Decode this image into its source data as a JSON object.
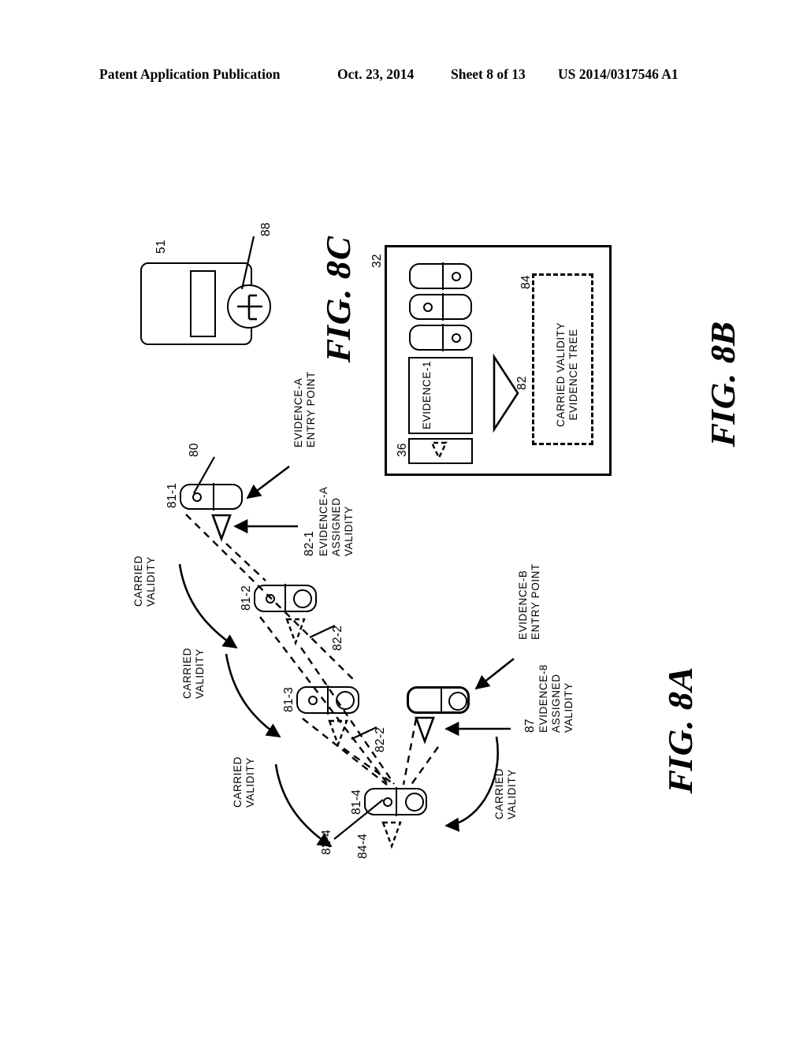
{
  "header": {
    "publication": "Patent Application Publication",
    "date": "Oct. 23, 2014",
    "sheet": "Sheet 8 of 13",
    "number": "US 2014/0317546 A1"
  },
  "figures": {
    "fig8a": {
      "title": "FIG. 8A",
      "nodes": [
        {
          "id": "81-1",
          "label": "81-1"
        },
        {
          "id": "81-2",
          "label": "81-2"
        },
        {
          "id": "81-3",
          "label": "81-3"
        },
        {
          "id": "81-4",
          "label": "81-4"
        }
      ],
      "refs": {
        "n80": "80",
        "n82_1": "82-1",
        "n82_2a": "82-2",
        "n82_2b": "82-2",
        "n82_4": "82-4",
        "n84_4": "84-4",
        "n87": "87"
      },
      "annotations": {
        "evidence_a_entry": "EVIDENCE-A\nENTRY POINT",
        "evidence_a_validity": "EVIDENCE-A\nASSIGNED\nVALIDITY",
        "evidence_b_entry": "EVIDENCE-B\nENTRY POINT",
        "evidence_b_validity": "EVIDENCE-8\nASSIGNED\nVALIDITY",
        "carried_validity_1": "CARRIED\nVALIDITY",
        "carried_validity_2": "CARRIED\nVALIDITY",
        "carried_validity_3": "CARRIED\nVALIDITY",
        "carried_validity_4": "CARRIED\nVALIDITY"
      }
    },
    "fig8b": {
      "title": "FIG. 8B",
      "refs": {
        "container": "32",
        "input_box": "36",
        "arrow": "82",
        "tree": "84"
      },
      "evidence_label": "EVIDENCE-1",
      "tree_label": "CARRIED VALIDITY\nEVIDENCE TREE"
    },
    "fig8c": {
      "title": "FIG. 8C",
      "refs": {
        "device": "51",
        "marker": "88"
      }
    }
  }
}
